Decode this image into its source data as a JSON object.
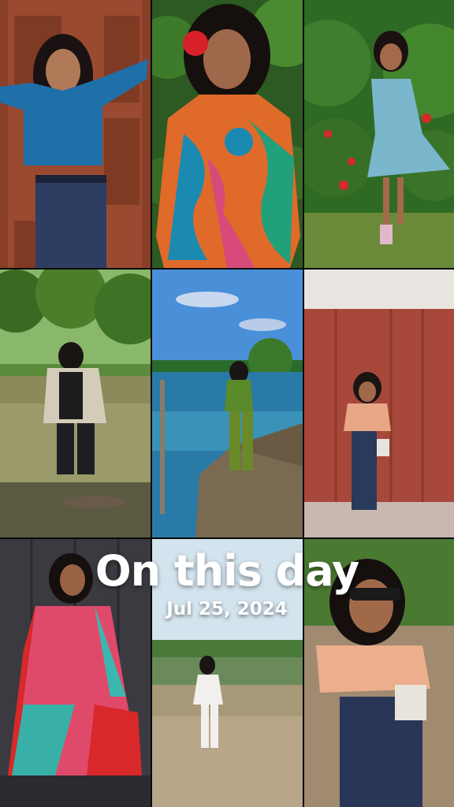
{
  "overlay": {
    "title": "On this day",
    "date": "Jul 25, 2024"
  },
  "photos": [
    {
      "subject": "woman in blue crop top against wooden door"
    },
    {
      "subject": "woman in colorful dress with red flower in hair"
    },
    {
      "subject": "woman in light blue dress near red flowers"
    },
    {
      "subject": "woman standing in shallow river"
    },
    {
      "subject": "woman in green outfit on seaside rocks"
    },
    {
      "subject": "woman in peach top against red wooden wall"
    },
    {
      "subject": "woman in pink and teal tiered dress"
    },
    {
      "subject": "woman in white outfit on wall near lagoon"
    },
    {
      "subject": "woman in peach top with sunglasses"
    }
  ]
}
